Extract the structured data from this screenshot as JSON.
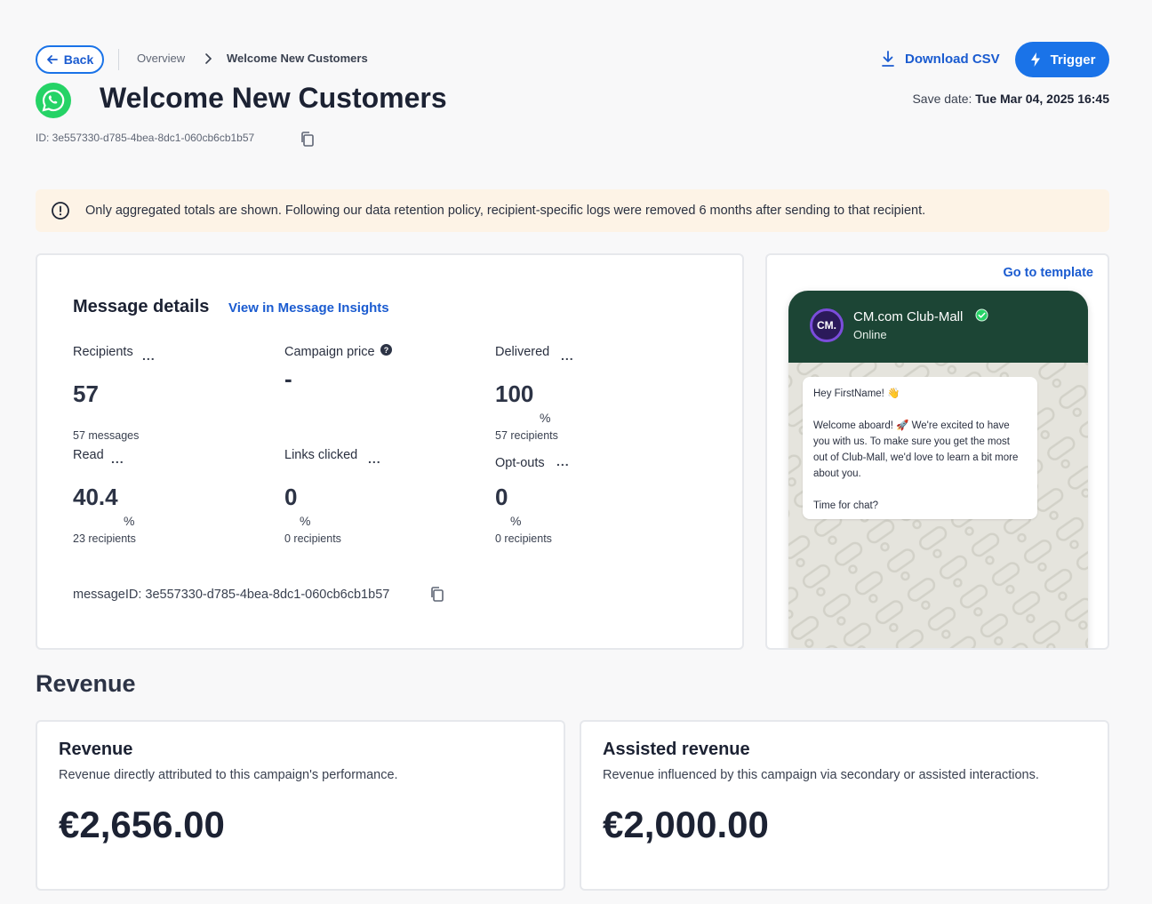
{
  "nav": {
    "back_label": "Back",
    "breadcrumb": [
      "Overview",
      "Welcome New Customers"
    ]
  },
  "header": {
    "title": "Welcome New Customers",
    "id_text": "ID: 3e557330-d785-4bea-8dc1-060cb6cb1b57",
    "download_label": "Download CSV",
    "trigger_label": "Trigger",
    "save_date_label": "Save date:",
    "save_date_value": "Tue Mar 04, 2025 16:45"
  },
  "notice": {
    "text": "Only aggregated totals are shown. Following our data retention policy, recipient-specific logs were removed 6 months after sending to that recipient."
  },
  "message_details": {
    "title": "Message details",
    "insights_link": "View in Message Insights",
    "metrics": [
      {
        "label": "Recipients",
        "value": "57",
        "unit": "",
        "sub": "57 messages"
      },
      {
        "label": "Campaign price",
        "value": "-",
        "unit": "",
        "sub": ""
      },
      {
        "label": "Delivered",
        "value": "100",
        "unit": "%",
        "sub": "57 recipients"
      },
      {
        "label": "Read",
        "value": "40.4",
        "unit": "%",
        "sub": "23 recipients"
      },
      {
        "label": "Links clicked",
        "value": "0",
        "unit": "%",
        "sub": "0 recipients"
      },
      {
        "label": "Opt-outs",
        "value": "0",
        "unit": "%",
        "sub": "0 recipients"
      }
    ],
    "more_glyph": "...",
    "help_glyph": "?",
    "message_id": "messageID: 3e557330-d785-4bea-8dc1-060cb6cb1b57"
  },
  "template": {
    "link": "Go to template",
    "avatar_text": "CM.",
    "sender": "CM.com Club-Mall",
    "status": "Online",
    "bubble_lines": [
      "Hey FirstName! 👋",
      "",
      "Welcome aboard! 🚀 We're excited to have you with us. To make sure you get the most out of Club-Mall, we'd love to learn a bit more about you.",
      "",
      "Time for chat?"
    ]
  },
  "revenue": {
    "heading": "Revenue",
    "cards": [
      {
        "title": "Revenue",
        "desc": "Revenue directly attributed to this campaign's performance.",
        "value": "€2,656.00"
      },
      {
        "title": "Assisted revenue",
        "desc": "Revenue influenced by this campaign via secondary or assisted interactions.",
        "value": "€2,000.00"
      }
    ]
  },
  "colors": {
    "accent": "#1a73e8",
    "notice_bg": "#fdf3e6",
    "chat_header": "#1c4535",
    "whatsapp_green": "#25d366"
  }
}
